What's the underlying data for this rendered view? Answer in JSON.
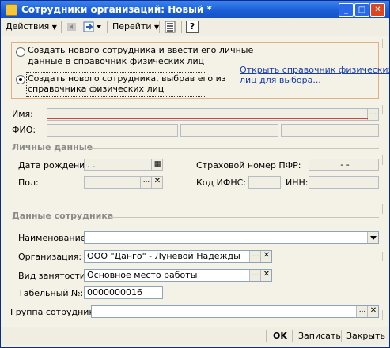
{
  "window": {
    "title": "Сотрудники организаций: Новый *"
  },
  "toolbar": {
    "actions_label": "Действия",
    "goto_label": "Перейти",
    "help_label": "?"
  },
  "choice": {
    "option1": "Создать нового сотрудника и ввести его личные данные в справочник физических лиц",
    "option1_line1": "Создать нового сотрудника и ввести его личные",
    "option1_line2": "данные в справочник физических лиц",
    "option2_line1": "Создать нового сотрудника, выбрав его из",
    "option2_line2": "справочника физических лиц",
    "selected": 2,
    "link_line1": "Открыть справочник физических",
    "link_line2": "лиц для выбора..."
  },
  "fields": {
    "name_label": "Имя:",
    "name_value": "",
    "fio_label": "ФИО:"
  },
  "personal": {
    "section_title": "Личные данные",
    "birthdate_label": "Дата рождения:",
    "birthdate_value": " .  .",
    "gender_label": "Пол:",
    "pfr_label": "Страховой номер ПФР:",
    "pfr_value": "-   -",
    "ifns_label": "Код ИФНС:",
    "inn_label": "ИНН:"
  },
  "employee": {
    "section_title": "Данные сотрудника",
    "name_label": "Наименование:",
    "name_value": "",
    "org_label": "Организация:",
    "org_value": "ООО \"Данго\" - Луневой Надежды",
    "employment_label": "Вид занятости:",
    "employment_value": "Основное место работы",
    "tabnum_label": "Табельный №:",
    "tabnum_value": "0000000016",
    "group_label": "Группа сотрудника:",
    "group_value": ""
  },
  "footer": {
    "ok_label": "OK",
    "save_label": "Записать",
    "close_label": "Закрыть"
  }
}
